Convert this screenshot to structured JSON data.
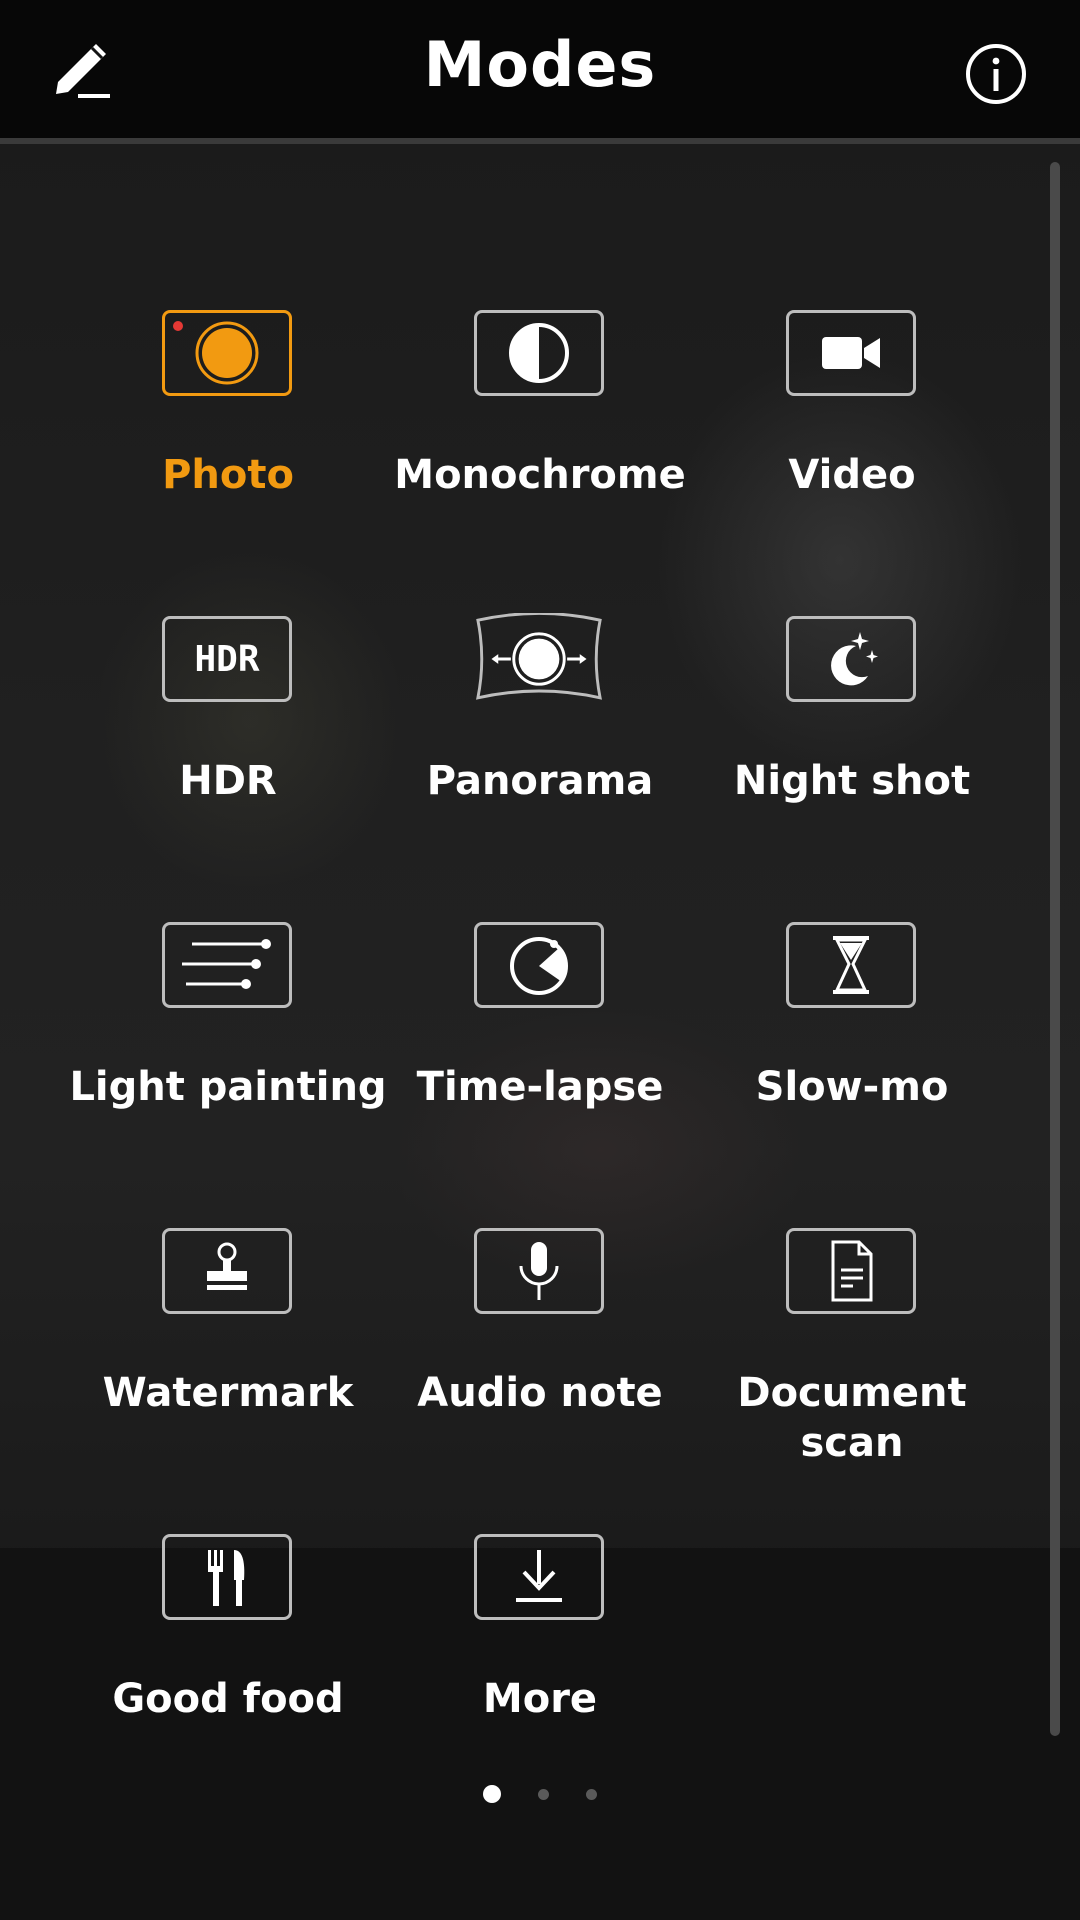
{
  "header": {
    "title": "Modes",
    "edit_icon": "pencil-edit-icon",
    "info_icon": "info-circle-icon"
  },
  "colors": {
    "accent": "#f29a11",
    "text": "#ffffff",
    "recording_dot": "#e53935"
  },
  "modes": [
    {
      "label": "Photo",
      "icon": "photo-shutter-icon",
      "active": true
    },
    {
      "label": "Monochrome",
      "icon": "monochrome-icon",
      "active": false
    },
    {
      "label": "Video",
      "icon": "video-camera-icon",
      "active": false
    },
    {
      "label": "HDR",
      "icon": "hdr-icon",
      "icon_text": "HDR",
      "active": false
    },
    {
      "label": "Panorama",
      "icon": "panorama-icon",
      "active": false
    },
    {
      "label": "Night shot",
      "icon": "night-moon-icon",
      "active": false
    },
    {
      "label": "Light painting",
      "icon": "light-painting-icon",
      "active": false
    },
    {
      "label": "Time-lapse",
      "icon": "time-lapse-icon",
      "active": false
    },
    {
      "label": "Slow-mo",
      "icon": "hourglass-icon",
      "active": false
    },
    {
      "label": "Watermark",
      "icon": "stamp-icon",
      "active": false
    },
    {
      "label": "Audio note",
      "icon": "microphone-icon",
      "active": false
    },
    {
      "label": "Document scan",
      "icon": "document-icon",
      "active": false
    },
    {
      "label": "Good food",
      "icon": "fork-knife-icon",
      "active": false
    },
    {
      "label": "More",
      "icon": "download-icon",
      "active": false
    }
  ],
  "pagination": {
    "pages": 3,
    "current": 1
  }
}
